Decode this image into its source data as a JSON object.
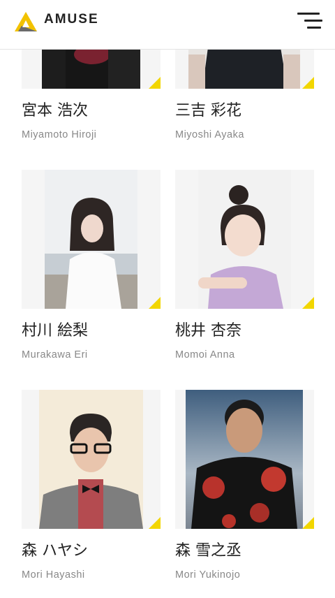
{
  "header": {
    "brand": "AMUSE",
    "logo_icon": "amuse-triangle-logo",
    "menu_icon": "hamburger-menu-icon",
    "colors": {
      "logo_yellow": "#f2c200",
      "logo_gray": "#6b6b6b",
      "accent": "#f2d600"
    }
  },
  "talents": [
    {
      "name_ja": "宮本 浩次",
      "name_en": "Miyamoto Hiroji"
    },
    {
      "name_ja": "三吉 彩花",
      "name_en": "Miyoshi Ayaka"
    },
    {
      "name_ja": "村川 絵梨",
      "name_en": "Murakawa Eri"
    },
    {
      "name_ja": "桃井 杏奈",
      "name_en": "Momoi Anna"
    },
    {
      "name_ja": "森 ハヤシ",
      "name_en": "Mori Hayashi"
    },
    {
      "name_ja": "森 雪之丞",
      "name_en": "Mori Yukinojo"
    }
  ]
}
